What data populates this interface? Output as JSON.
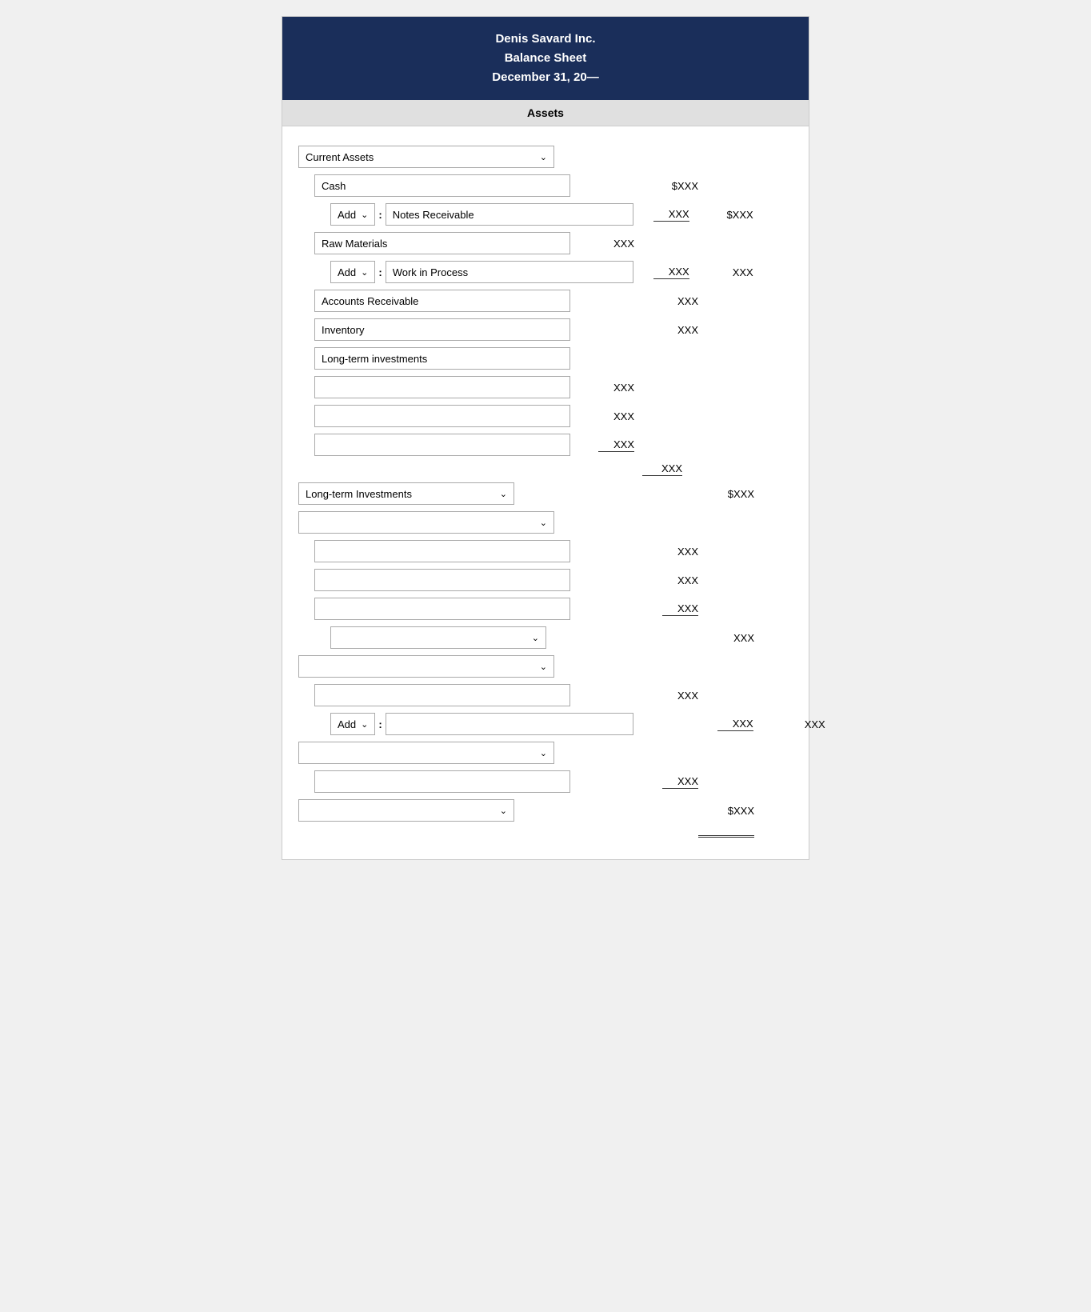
{
  "header": {
    "company": "Denis Savard Inc.",
    "doc_type": "Balance Sheet",
    "date": "December 31, 20—"
  },
  "assets_label": "Assets",
  "sections": {
    "current_assets": "Current Assets",
    "long_term_investments": "Long-term Investments",
    "long_term_investments2": "Long-term Investments"
  },
  "labels": {
    "cash": "Cash",
    "add": "Add",
    "notes_receivable": "Notes Receivable",
    "raw_materials": "Raw Materials",
    "work_in_process": "Work in Process",
    "accounts_receivable": "Accounts Receivable",
    "inventory": "Inventory",
    "long_term_investments": "Long-term investments",
    "colon": ":"
  },
  "values": {
    "xxx": "XXX",
    "sxxx": "$XXX"
  }
}
